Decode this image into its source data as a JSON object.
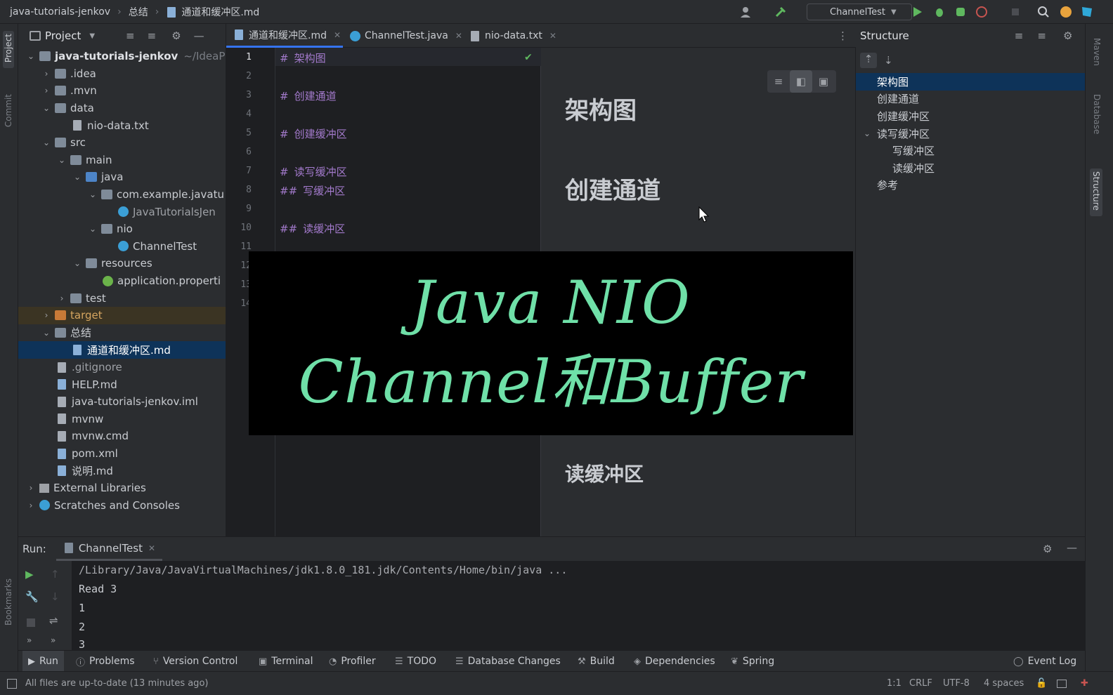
{
  "titlebar": {
    "project": "java-tutorials-jenkov",
    "folder": "总结",
    "file": "通道和缓冲区.md",
    "run_config": "ChannelTest"
  },
  "left_strip": {
    "project": "Project",
    "commit": "Commit",
    "bookmarks": "Bookmarks"
  },
  "project_panel": {
    "title": "Project",
    "items": [
      {
        "label": "java-tutorials-jenkov",
        "extra": "~/IdeaP"
      },
      {
        "label": ".idea"
      },
      {
        "label": ".mvn"
      },
      {
        "label": "data"
      },
      {
        "label": "nio-data.txt"
      },
      {
        "label": "src"
      },
      {
        "label": "main"
      },
      {
        "label": "java"
      },
      {
        "label": "com.example.javatu"
      },
      {
        "label": "JavaTutorialsJen"
      },
      {
        "label": "nio"
      },
      {
        "label": "ChannelTest"
      },
      {
        "label": "resources"
      },
      {
        "label": "application.properti"
      },
      {
        "label": "test"
      },
      {
        "label": "target"
      },
      {
        "label": "总结"
      },
      {
        "label": "通道和缓冲区.md"
      },
      {
        "label": ".gitignore"
      },
      {
        "label": "HELP.md"
      },
      {
        "label": "java-tutorials-jenkov.iml"
      },
      {
        "label": "mvnw"
      },
      {
        "label": "mvnw.cmd"
      },
      {
        "label": "pom.xml"
      },
      {
        "label": "说明.md"
      },
      {
        "label": "External Libraries"
      },
      {
        "label": "Scratches and Consoles"
      }
    ]
  },
  "editor": {
    "tabs": [
      {
        "label": "通道和缓冲区.md"
      },
      {
        "label": "ChannelTest.java"
      },
      {
        "label": "nio-data.txt"
      }
    ],
    "line_numbers": [
      "1",
      "2",
      "3",
      "4",
      "5",
      "6",
      "7",
      "8",
      "9",
      "10",
      "11",
      "12",
      "13",
      "14"
    ],
    "code": [
      {
        "mark": "#",
        "text": "架构图"
      },
      {
        "mark": "#",
        "text": "创建通道"
      },
      {
        "mark": "#",
        "text": "创建缓冲区"
      },
      {
        "mark": "#",
        "text": "读写缓冲区"
      },
      {
        "mark": "##",
        "text": "写缓冲区"
      },
      {
        "mark": "##",
        "text": "读缓冲区"
      }
    ]
  },
  "preview": {
    "headings": [
      "架构图",
      "创建通道",
      "读缓冲区"
    ]
  },
  "banner": {
    "line1": "Java NIO",
    "line2": "Channel和Buffer"
  },
  "structure": {
    "title": "Structure",
    "items": [
      "架构图",
      "创建通道",
      "创建缓冲区",
      "读写缓冲区",
      "写缓冲区",
      "读缓冲区",
      "参考"
    ]
  },
  "right_strip": {
    "maven": "Maven",
    "database": "Database",
    "structure": "Structure"
  },
  "run": {
    "label": "Run:",
    "tab": "ChannelTest",
    "console": [
      "/Library/Java/JavaVirtualMachines/jdk1.8.0_181.jdk/Contents/Home/bin/java ...",
      "Read 3",
      "1",
      "2",
      "3"
    ]
  },
  "bottom_tools": [
    "Run",
    "Problems",
    "Version Control",
    "Terminal",
    "Profiler",
    "TODO",
    "Database Changes",
    "Build",
    "Dependencies",
    "Spring",
    "Event Log"
  ],
  "status": {
    "message": "All files are up-to-date (13 minutes ago)",
    "position": "1:1",
    "line_sep": "CRLF",
    "encoding": "UTF-8",
    "indent": "4 spaces"
  },
  "colors": {
    "accent": "#3574f0",
    "selection": "#0e3359",
    "banner_text": "#6fe0a8",
    "markdown_heading": "#a37acc"
  }
}
